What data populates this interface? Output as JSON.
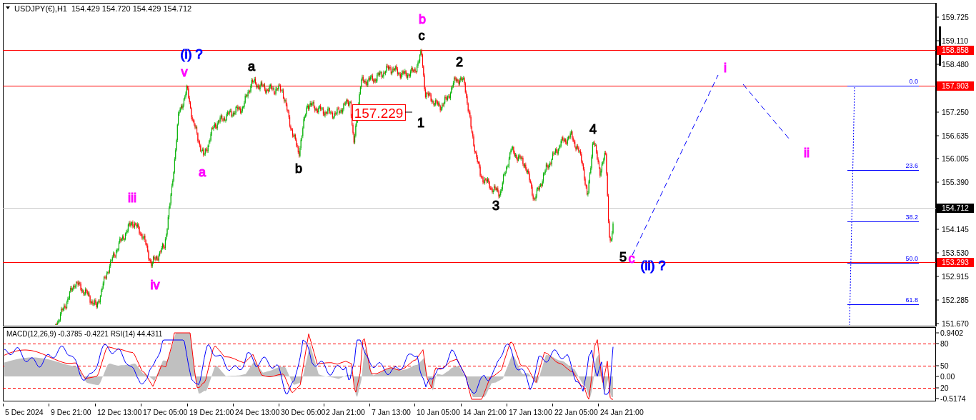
{
  "header": {
    "symbol": "USDJPY(€),H1",
    "ohlc": "154.429 154.720 154.429 154.712"
  },
  "price_axis": {
    "ticks": [
      "159.725",
      "159.110",
      "158.480",
      "157.250",
      "156.635",
      "156.005",
      "155.390",
      "154.145",
      "153.530",
      "152.915",
      "152.285",
      "151.670"
    ],
    "markers": [
      {
        "label": "158.858",
        "kind": "level"
      },
      {
        "label": "157.903",
        "kind": "level"
      },
      {
        "label": "154.712",
        "kind": "current"
      },
      {
        "label": "153.293",
        "kind": "level"
      }
    ]
  },
  "wave_labels": [
    {
      "text": "b",
      "color": "#ff00ff"
    },
    {
      "text": "c",
      "color": "#000000"
    },
    {
      "text": "(i) ?",
      "color": "#0000ff"
    },
    {
      "text": "v",
      "color": "#ff00ff"
    },
    {
      "text": "a",
      "color": "#000000"
    },
    {
      "text": "2",
      "color": "#000000"
    },
    {
      "text": "1",
      "color": "#000000"
    },
    {
      "text": "4",
      "color": "#000000"
    },
    {
      "text": "a",
      "color": "#ff00ff"
    },
    {
      "text": "b",
      "color": "#000000"
    },
    {
      "text": "3",
      "color": "#000000"
    },
    {
      "text": "iii",
      "color": "#ff00ff"
    },
    {
      "text": "iv",
      "color": "#ff00ff"
    },
    {
      "text": "5",
      "color": "#000000"
    },
    {
      "text": "c",
      "color": "#ff00ff"
    },
    {
      "text": "(ii) ?",
      "color": "#0000ff"
    },
    {
      "text": "i",
      "color": "#ff00ff"
    },
    {
      "text": "ii",
      "color": "#ff00ff"
    }
  ],
  "price_box": "157.229",
  "fibonacci_levels": [
    "0.0",
    "23.6",
    "38.2",
    "50.0",
    "61.8"
  ],
  "indicator": {
    "title": "MACD(12,26,9) -0.3785 -0.4221  RSI(14) 44.4311",
    "axis": [
      "0.9402",
      "80",
      "50",
      "0.00",
      "20",
      "-0.5174"
    ]
  },
  "time_axis": [
    "5 Dec 2024",
    "9 Dec 21:00",
    "12 Dec 13:00",
    "17 Dec 05:00",
    "19 Dec 21:00",
    "24 Dec 13:00",
    "30 Dec 05:00",
    "2 Jan 21:00",
    "7 Jan 13:00",
    "10 Jan 05:00",
    "14 Jan 21:00",
    "17 Jan 13:00",
    "22 Jan 05:00",
    "24 Jan 21:00"
  ]
}
